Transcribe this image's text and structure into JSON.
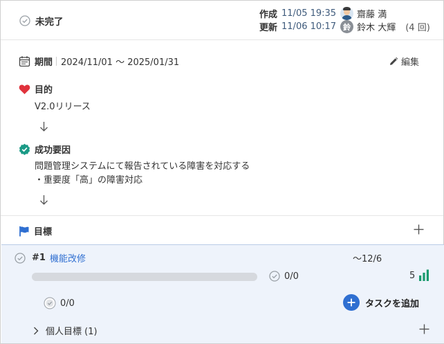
{
  "header": {
    "status": "未完了",
    "created": {
      "label": "作成",
      "datetime": "11/05 19:35",
      "user": "齋藤 満"
    },
    "updated": {
      "label": "更新",
      "datetime": "11/06 10:17",
      "avatar_initial": "鈴",
      "user": "鈴木 大輝",
      "count": "(4 回)"
    }
  },
  "period": {
    "label": "期間",
    "value": "2024/11/01 〜 2025/01/31"
  },
  "edit_label": "編集",
  "purpose": {
    "title": "目的",
    "text": "V2.0リリース"
  },
  "success": {
    "title": "成功要因",
    "lines": [
      "問題管理システムにて報告されている障害を対応する",
      "・重要度「高」の障害対応"
    ]
  },
  "goals_section": {
    "title": "目標"
  },
  "goal": {
    "number": "#1",
    "title": "機能改修",
    "due": "〜12/6",
    "progress": 0,
    "tasks": "0/0",
    "level": "5",
    "subtasks": "0/0",
    "add_task_label": "タスクを追加",
    "personal_label": "個人目標 (1)"
  },
  "colors": {
    "accent": "#2f6fd1",
    "heart": "#e0323c",
    "shield": "#1a9a86",
    "level": "#1a9a6e"
  }
}
